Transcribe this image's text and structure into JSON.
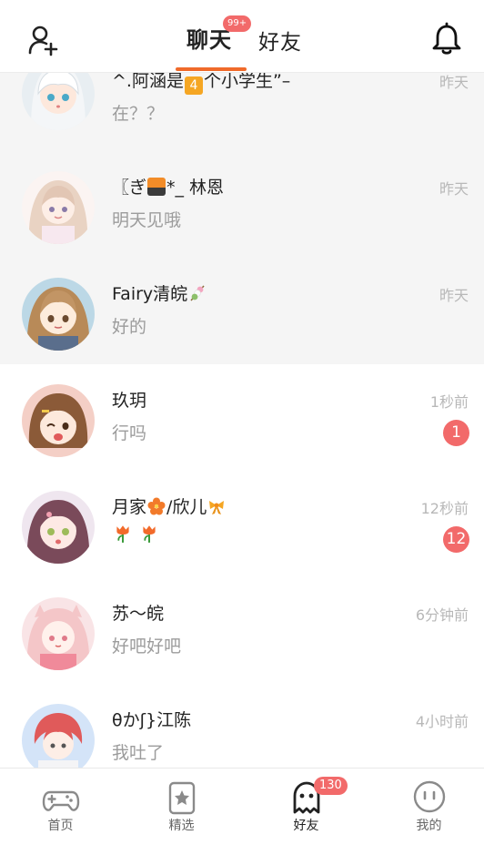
{
  "header": {
    "tab_chat": "聊天",
    "tab_chat_badge": "99+",
    "tab_friends": "好友",
    "add_friend_icon": "person-plus-icon",
    "bell_icon": "bell-icon"
  },
  "colors": {
    "accent": "#f06a2a",
    "badge": "#f26a6a",
    "pinned_bg": "#f5f5f5"
  },
  "conversations": [
    {
      "name": "^.阿涵是",
      "name_emoji": "4",
      "name_suffix": "个小学生”–",
      "message": "在？？",
      "time": "昨天"
    },
    {
      "name_prefix": "〖ぎ",
      "name_suffix": "*_ 林恩",
      "message": "明天见哦",
      "time": "昨天"
    },
    {
      "name": "Fairy清皖",
      "message": "好的",
      "time": "昨天"
    },
    {
      "name": "玖玥",
      "message": "行吗",
      "time": "1秒前",
      "unread": "1"
    },
    {
      "name_prefix": "月家",
      "name_suffix": "/欣儿",
      "message": "",
      "time": "12秒前",
      "unread": "12"
    },
    {
      "name": "苏～皖",
      "message": "好吧好吧",
      "time": "6分钟前"
    },
    {
      "name": "θかʃ}江陈",
      "message": "我吐了",
      "time": "4小时前"
    }
  ],
  "bottom_nav": [
    {
      "label": "首页",
      "icon": "gamepad-icon"
    },
    {
      "label": "精选",
      "icon": "star-card-icon"
    },
    {
      "label": "好友",
      "icon": "ghost-icon",
      "badge": "130"
    },
    {
      "label": "我的",
      "icon": "face-icon"
    }
  ]
}
